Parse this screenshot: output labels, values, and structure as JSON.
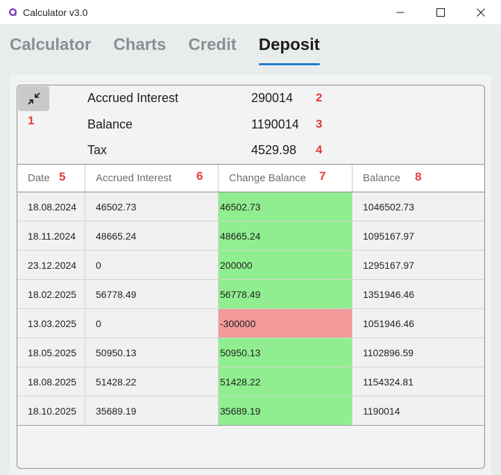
{
  "window": {
    "title": "Calculator v3.0",
    "controls": [
      "minimize-icon",
      "maximize-icon",
      "close-icon"
    ]
  },
  "tabs": [
    {
      "label": "Calculator",
      "active": false
    },
    {
      "label": "Charts",
      "active": false
    },
    {
      "label": "Credit",
      "active": false
    },
    {
      "label": "Deposit",
      "active": true
    }
  ],
  "summary": {
    "collapse_icon": "collapse-arrows-icon",
    "rows": [
      {
        "label": "Accrued Interest",
        "value": "290014"
      },
      {
        "label": "Balance",
        "value": "1190014"
      },
      {
        "label": "Tax",
        "value": "4529.98"
      }
    ]
  },
  "table": {
    "headers": [
      "Date",
      "Accrued Interest",
      "Change Balance",
      "Balance"
    ],
    "rows": [
      {
        "date": "18.08.2024",
        "interest": "46502.73",
        "change": "46502.73",
        "balance": "1046502.73",
        "type": "pos"
      },
      {
        "date": "18.11.2024",
        "interest": "48665.24",
        "change": "48665.24",
        "balance": "1095167.97",
        "type": "pos"
      },
      {
        "date": "23.12.2024",
        "interest": "0",
        "change": "200000",
        "balance": "1295167.97",
        "type": "pos"
      },
      {
        "date": "18.02.2025",
        "interest": "56778.49",
        "change": "56778.49",
        "balance": "1351946.46",
        "type": "pos"
      },
      {
        "date": "13.03.2025",
        "interest": "0",
        "change": "-300000",
        "balance": "1051946.46",
        "type": "neg"
      },
      {
        "date": "18.05.2025",
        "interest": "50950.13",
        "change": "50950.13",
        "balance": "1102896.59",
        "type": "pos"
      },
      {
        "date": "18.08.2025",
        "interest": "51428.22",
        "change": "51428.22",
        "balance": "1154324.81",
        "type": "pos"
      },
      {
        "date": "18.10.2025",
        "interest": "35689.19",
        "change": "35689.19",
        "balance": "1190014",
        "type": "pos"
      }
    ]
  },
  "markers": [
    "1",
    "2",
    "3",
    "4",
    "5",
    "6",
    "7",
    "8"
  ],
  "colors": {
    "accent": "#1e7ad0",
    "positive_change": "#90ee90",
    "negative_change": "#f29a9a",
    "marker": "#e53b3b"
  }
}
